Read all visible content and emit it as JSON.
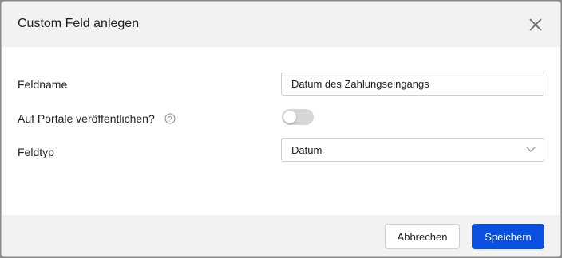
{
  "dialog": {
    "title": "Custom Feld anlegen"
  },
  "form": {
    "fieldname_label": "Feldname",
    "fieldname_value": "Datum des Zahlungseingangs",
    "publish_label": "Auf Portale veröffentlichen?",
    "publish_enabled": false,
    "fieldtype_label": "Feldtyp",
    "fieldtype_value": "Datum"
  },
  "footer": {
    "cancel_label": "Abbrechen",
    "save_label": "Speichern"
  },
  "colors": {
    "primary": "#0a4fe0",
    "toggle_off": "#d6d6d6"
  },
  "icons": {
    "close": "close-icon",
    "help": "help-circle-icon",
    "dropdown": "chevron-down-icon"
  }
}
